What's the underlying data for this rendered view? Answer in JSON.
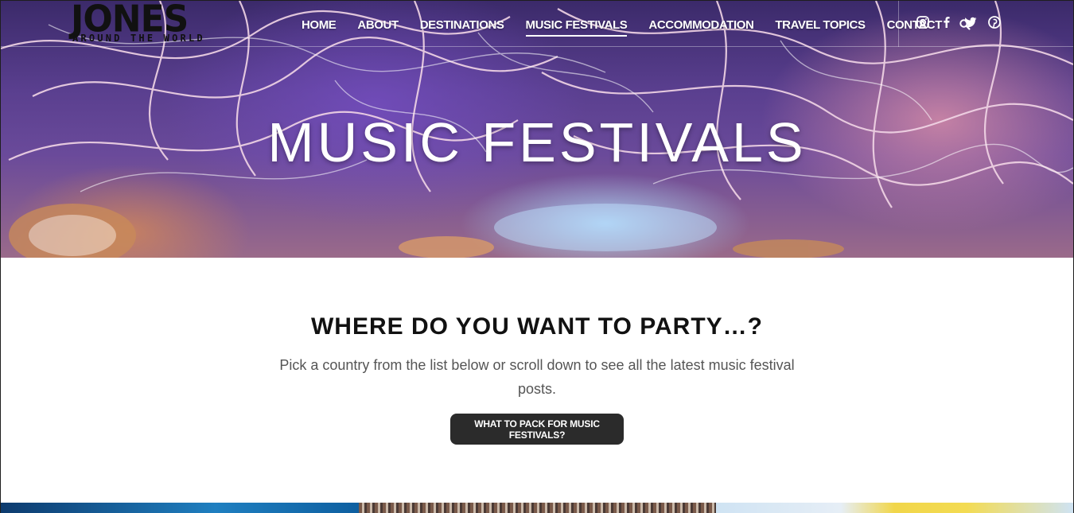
{
  "site": {
    "logo_main": "JONES",
    "logo_sub": "AROUND THE WORLD"
  },
  "nav": {
    "items": [
      {
        "label": "Home"
      },
      {
        "label": "About"
      },
      {
        "label": "Destinations"
      },
      {
        "label": "Music Festivals",
        "active": true
      },
      {
        "label": "Accommodation"
      },
      {
        "label": "Travel Topics"
      },
      {
        "label": "Contact"
      }
    ],
    "search_icon": "search-icon"
  },
  "social": {
    "icons": [
      "instagram-icon",
      "facebook-icon",
      "twitter-icon",
      "pinterest-icon"
    ]
  },
  "hero": {
    "title": "MUSIC FESTIVALS"
  },
  "intro": {
    "heading": "WHERE DO YOU WANT TO PARTY…?",
    "text": "Pick a country from the list below or scroll down to see all the latest music festival posts.",
    "button_label": "What to pack for music festivals?"
  },
  "colors": {
    "button_bg": "#2b2b2b",
    "heading": "#111111",
    "body_text": "#555555"
  }
}
